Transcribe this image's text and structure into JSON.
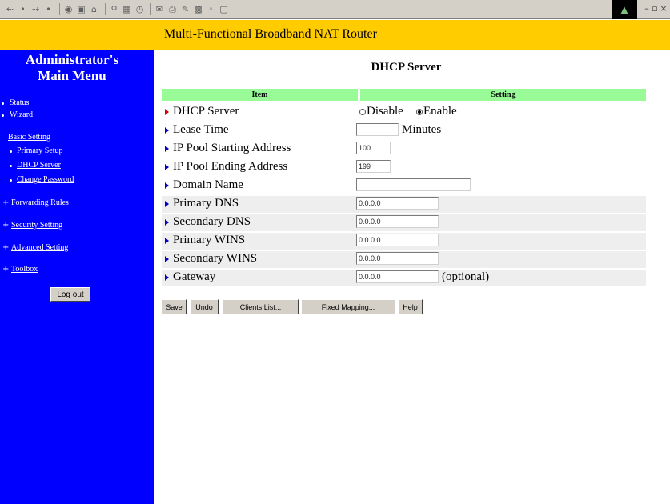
{
  "browser": {
    "toolbar_icons": [
      "back-icon",
      "dropdown-icon",
      "forward-icon",
      "dropdown-icon",
      "stop-icon",
      "refresh-icon",
      "home-icon",
      "search-icon",
      "favorites-icon",
      "history-icon",
      "mail-icon",
      "print-icon",
      "edit-icon",
      "discuss-icon",
      "messenger-icon",
      "dropdown-icon",
      "close-icon"
    ]
  },
  "banner": {
    "title": "Multi-Functional Broadband NAT Router",
    "color": "#ffcc00"
  },
  "sidebar": {
    "title_line1": "Administrator's",
    "title_line2": "Main Menu",
    "color": "#0000ff",
    "links": {
      "status": "Status",
      "wizard": "Wizard",
      "basic_setting": "Basic Setting",
      "primary_setup": "Primary Setup",
      "dhcp_server": "DHCP Server",
      "change_password": "Change Password",
      "forwarding_rules": "Forwarding Rules",
      "security_setting": "Security Setting",
      "advanced_setting": "Advanced Setting",
      "toolbox": "Toolbox"
    },
    "logout_label": "Log out"
  },
  "main": {
    "page_title": "DHCP Server",
    "table": {
      "header_item": "Item",
      "header_setting": "Setting",
      "header_color": "#98fb98",
      "rows": {
        "dhcp_server": {
          "label": "DHCP Server",
          "option_disable": "Disable",
          "option_enable": "Enable",
          "selected": "Enable"
        },
        "lease_time": {
          "label": "Lease Time",
          "value": "",
          "suffix": "Minutes"
        },
        "pool_start": {
          "label": "IP Pool Starting Address",
          "value": "100"
        },
        "pool_end": {
          "label": "IP Pool Ending Address",
          "value": "199"
        },
        "domain_name": {
          "label": "Domain Name",
          "value": ""
        },
        "primary_dns": {
          "label": "Primary DNS",
          "value": "0.0.0.0"
        },
        "secondary_dns": {
          "label": "Secondary DNS",
          "value": "0.0.0.0"
        },
        "primary_wins": {
          "label": "Primary WINS",
          "value": "0.0.0.0"
        },
        "secondary_wins": {
          "label": "Secondary WINS",
          "value": "0.0.0.0"
        },
        "gateway": {
          "label": "Gateway",
          "value": "0.0.0.0",
          "suffix": "(optional)"
        }
      }
    },
    "buttons": {
      "save": "Save",
      "undo": "Undo",
      "clients_list": "Clients List...",
      "fixed_mapping": "Fixed Mapping...",
      "help": "Help"
    }
  }
}
